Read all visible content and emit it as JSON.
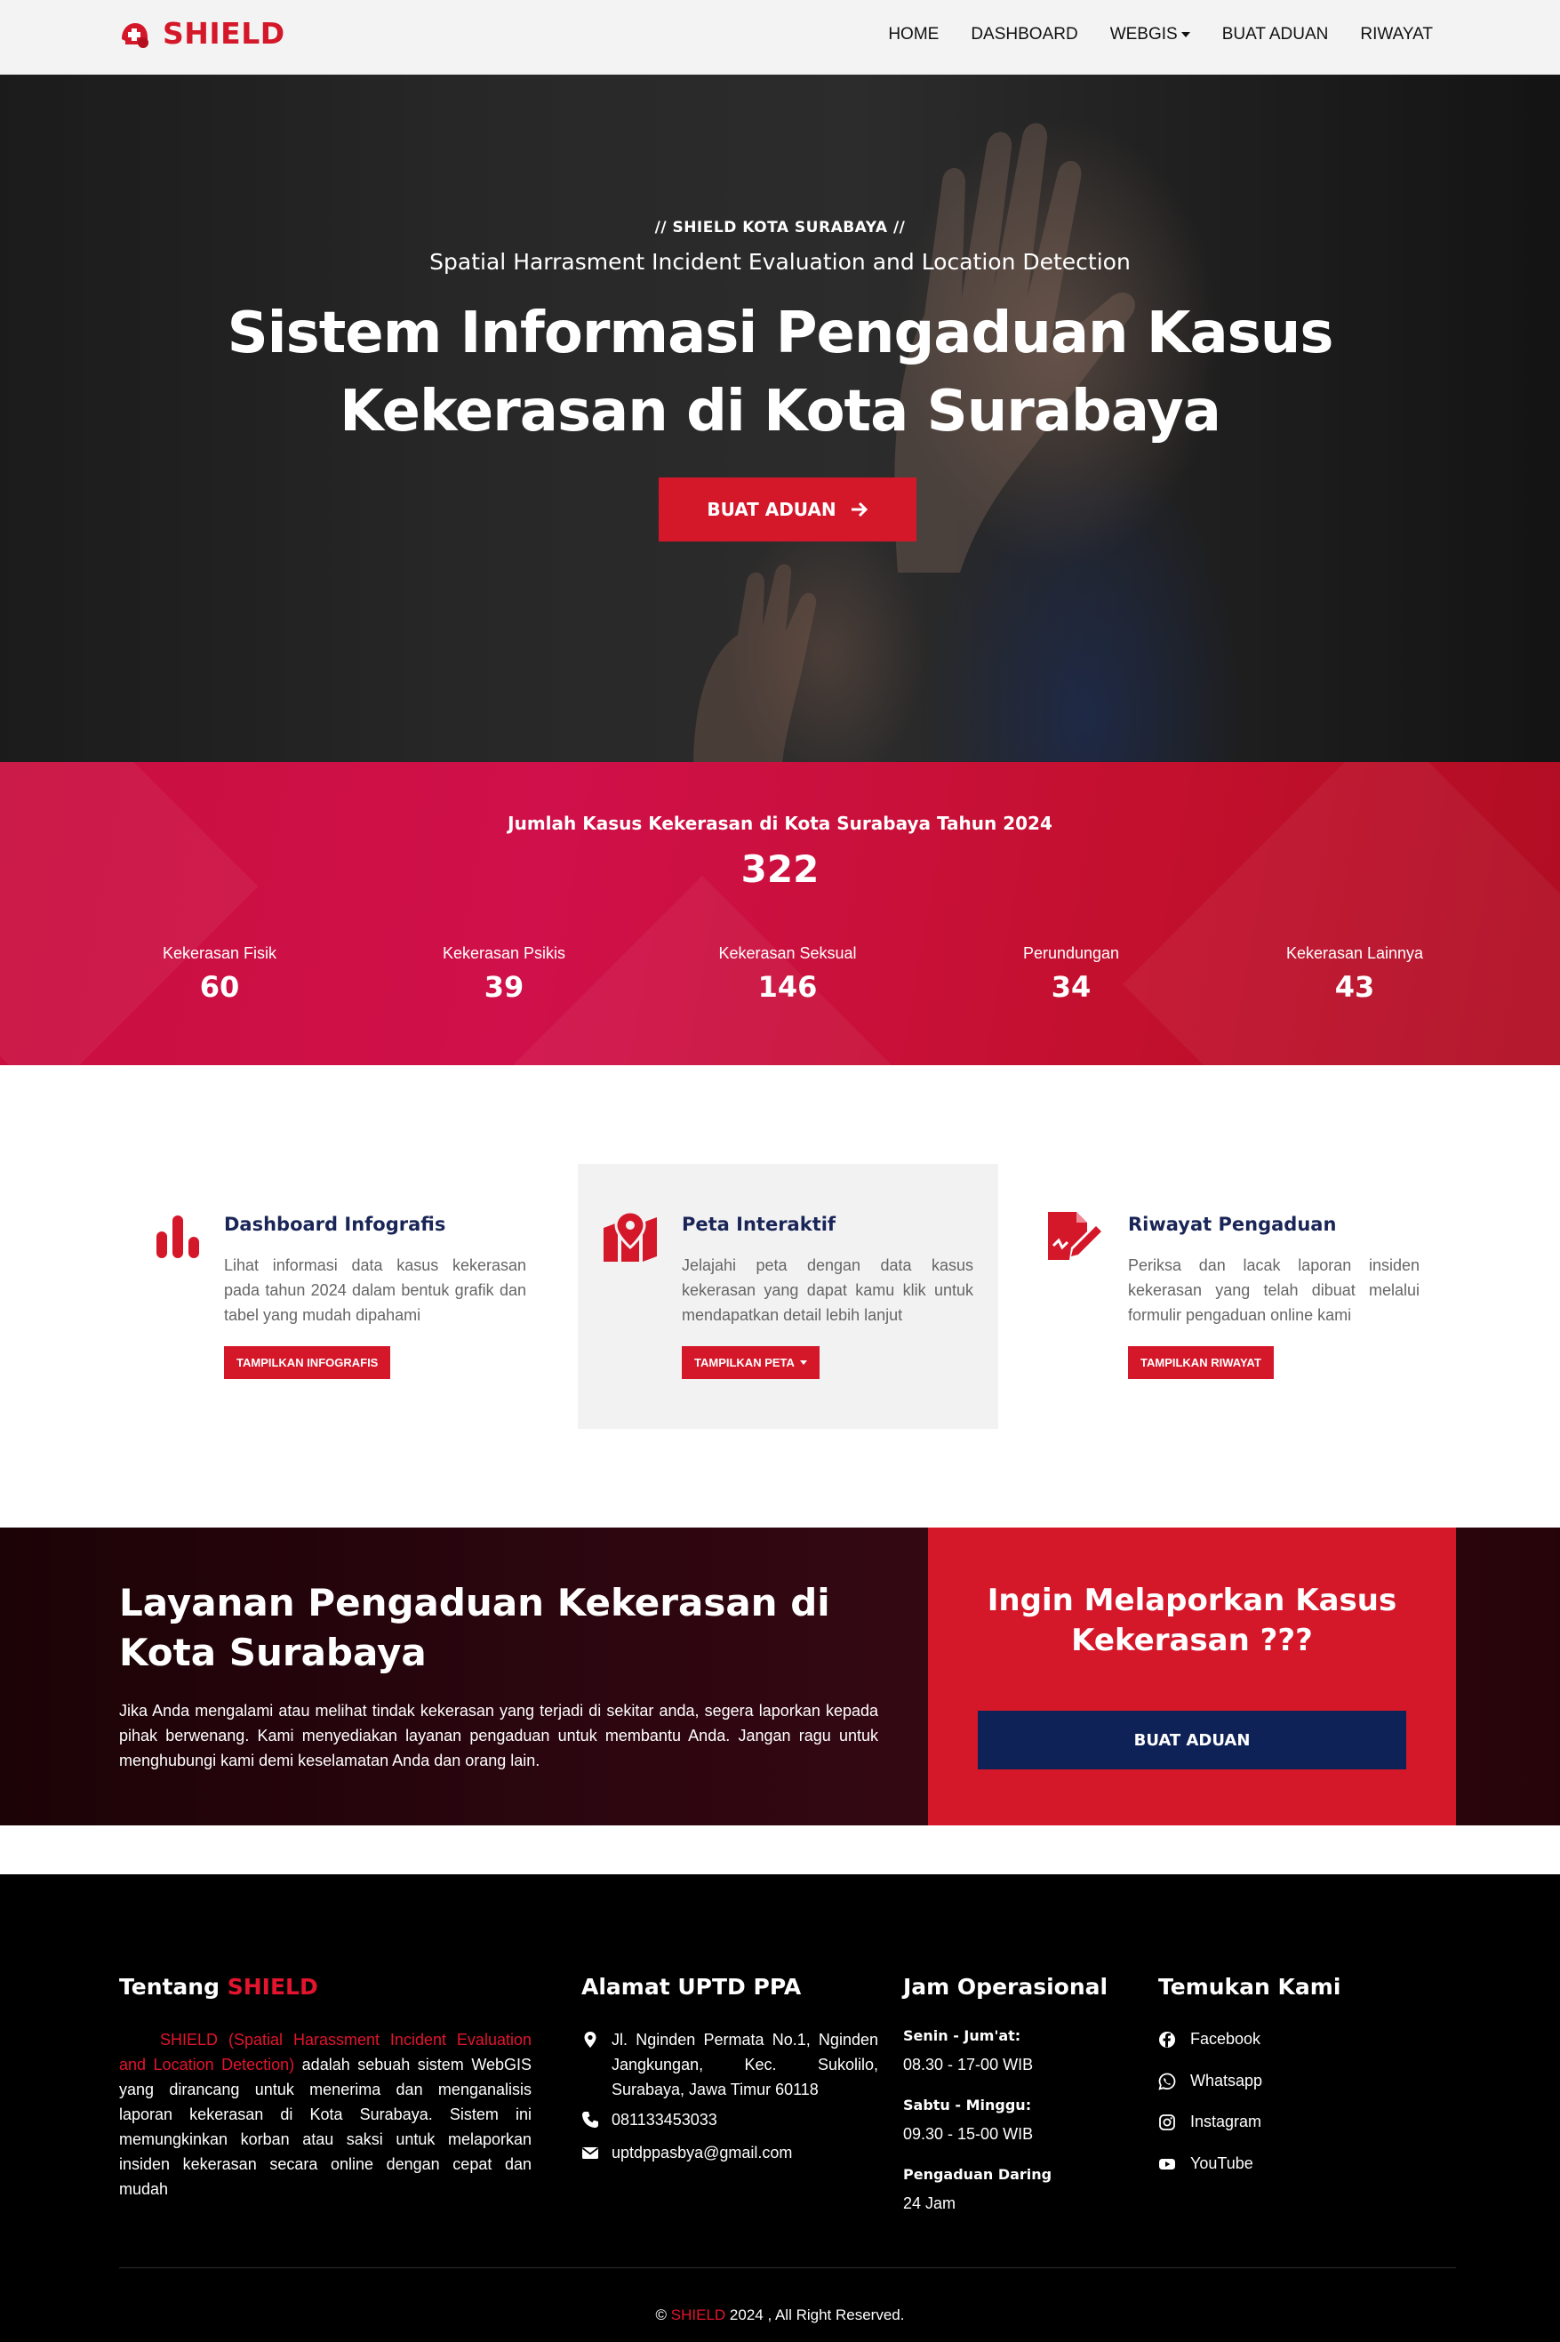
{
  "navbar": {
    "brand": "SHIELD",
    "links": [
      {
        "label": "HOME",
        "dropdown": false
      },
      {
        "label": "DASHBOARD",
        "dropdown": false
      },
      {
        "label": "WEBGIS",
        "dropdown": true
      },
      {
        "label": "BUAT ADUAN",
        "dropdown": false
      },
      {
        "label": "RIWAYAT",
        "dropdown": false
      }
    ]
  },
  "hero": {
    "kicker": "// SHIELD KOTA SURABAYA //",
    "subtitle": "Spatial Harrasment Incident Evaluation and Location Detection",
    "title_line1": "Sistem Informasi Pengaduan Kasus",
    "title_line2": "Kekerasan di Kota Surabaya",
    "button": "BUAT ADUAN"
  },
  "stats": {
    "heading": "Jumlah Kasus Kekerasan di Kota Surabaya Tahun 2024",
    "total": "322",
    "items": [
      {
        "label": "Kekerasan Fisik",
        "value": "60"
      },
      {
        "label": "Kekerasan Psikis",
        "value": "39"
      },
      {
        "label": "Kekerasan Seksual",
        "value": "146"
      },
      {
        "label": "Perundungan",
        "value": "34"
      },
      {
        "label": "Kekerasan Lainnya",
        "value": "43"
      }
    ]
  },
  "features": [
    {
      "icon": "bar-chart-icon",
      "title": "Dashboard Infografis",
      "text": "Lihat informasi data kasus kekerasan pada tahun 2024 dalam bentuk grafik dan tabel yang mudah dipahami",
      "button": "TAMPILKAN INFOGRAFIS"
    },
    {
      "icon": "map-marker-icon",
      "title": "Peta Interaktif",
      "text": "Jelajahi peta dengan data kasus kekerasan yang dapat kamu klik untuk mendapatkan detail lebih lanjut",
      "button": "TAMPILKAN PETA"
    },
    {
      "icon": "file-signature-icon",
      "title": "Riwayat Pengaduan",
      "text": "Periksa dan lacak laporan insiden kekerasan yang telah dibuat melalui formulir pengaduan online kami",
      "button": "TAMPILKAN RIWAYAT"
    }
  ],
  "cta": {
    "title": "Layanan Pengaduan Kekerasan di Kota Surabaya",
    "text": "Jika Anda mengalami atau melihat tindak kekerasan yang terjadi di sekitar anda, segera laporkan kepada pihak berwenang. Kami menyediakan layanan pengaduan untuk membantu Anda. Jangan ragu untuk menghubungi kami demi keselamatan Anda dan orang lain.",
    "box_title_line1": "Ingin Melaporkan Kasus",
    "box_title_line2": "Kekerasan ???",
    "box_button": "BUAT ADUAN"
  },
  "footer": {
    "about_heading_prefix": "Tentang",
    "about_heading_brand": "SHIELD",
    "about_highlight": "SHIELD (Spatial Harassment Incident Evaluation and Location Detection)",
    "about_text": " adalah sebuah sistem WebGIS yang dirancang untuk menerima dan menganalisis laporan kekerasan di Kota Surabaya. Sistem ini memungkinkan korban atau saksi untuk melaporkan insiden kekerasan secara online dengan cepat dan mudah",
    "address_heading": "Alamat UPTD PPA",
    "address": "Jl. Nginden Permata No.1, Nginden Jangkungan, Kec. Sukolilo, Surabaya, Jawa Timur 60118",
    "phone": "081133453033",
    "email": "uptdppasbya@gmail.com",
    "hours_heading": "Jam Operasional",
    "hours": [
      {
        "label": "Senin - Jum'at:",
        "value": "08.30 - 17-00 WIB"
      },
      {
        "label": "Sabtu - Minggu:",
        "value": "09.30 - 15-00 WIB"
      },
      {
        "label": "Pengaduan Daring",
        "value": "24 Jam"
      }
    ],
    "social_heading": "Temukan Kami",
    "social": [
      {
        "icon": "facebook-icon",
        "label": "Facebook"
      },
      {
        "icon": "whatsapp-icon",
        "label": "Whatsapp"
      },
      {
        "icon": "instagram-icon",
        "label": "Instagram"
      },
      {
        "icon": "youtube-icon",
        "label": "YouTube"
      }
    ],
    "copyright_prefix": "©",
    "copyright_brand": "SHIELD",
    "copyright_suffix": "2024 , All Right Reserved."
  },
  "colors": {
    "brand_red": "#d5172a",
    "navy": "#0f2257",
    "feature_title": "#1a2557",
    "footer_bg": "#000000"
  }
}
